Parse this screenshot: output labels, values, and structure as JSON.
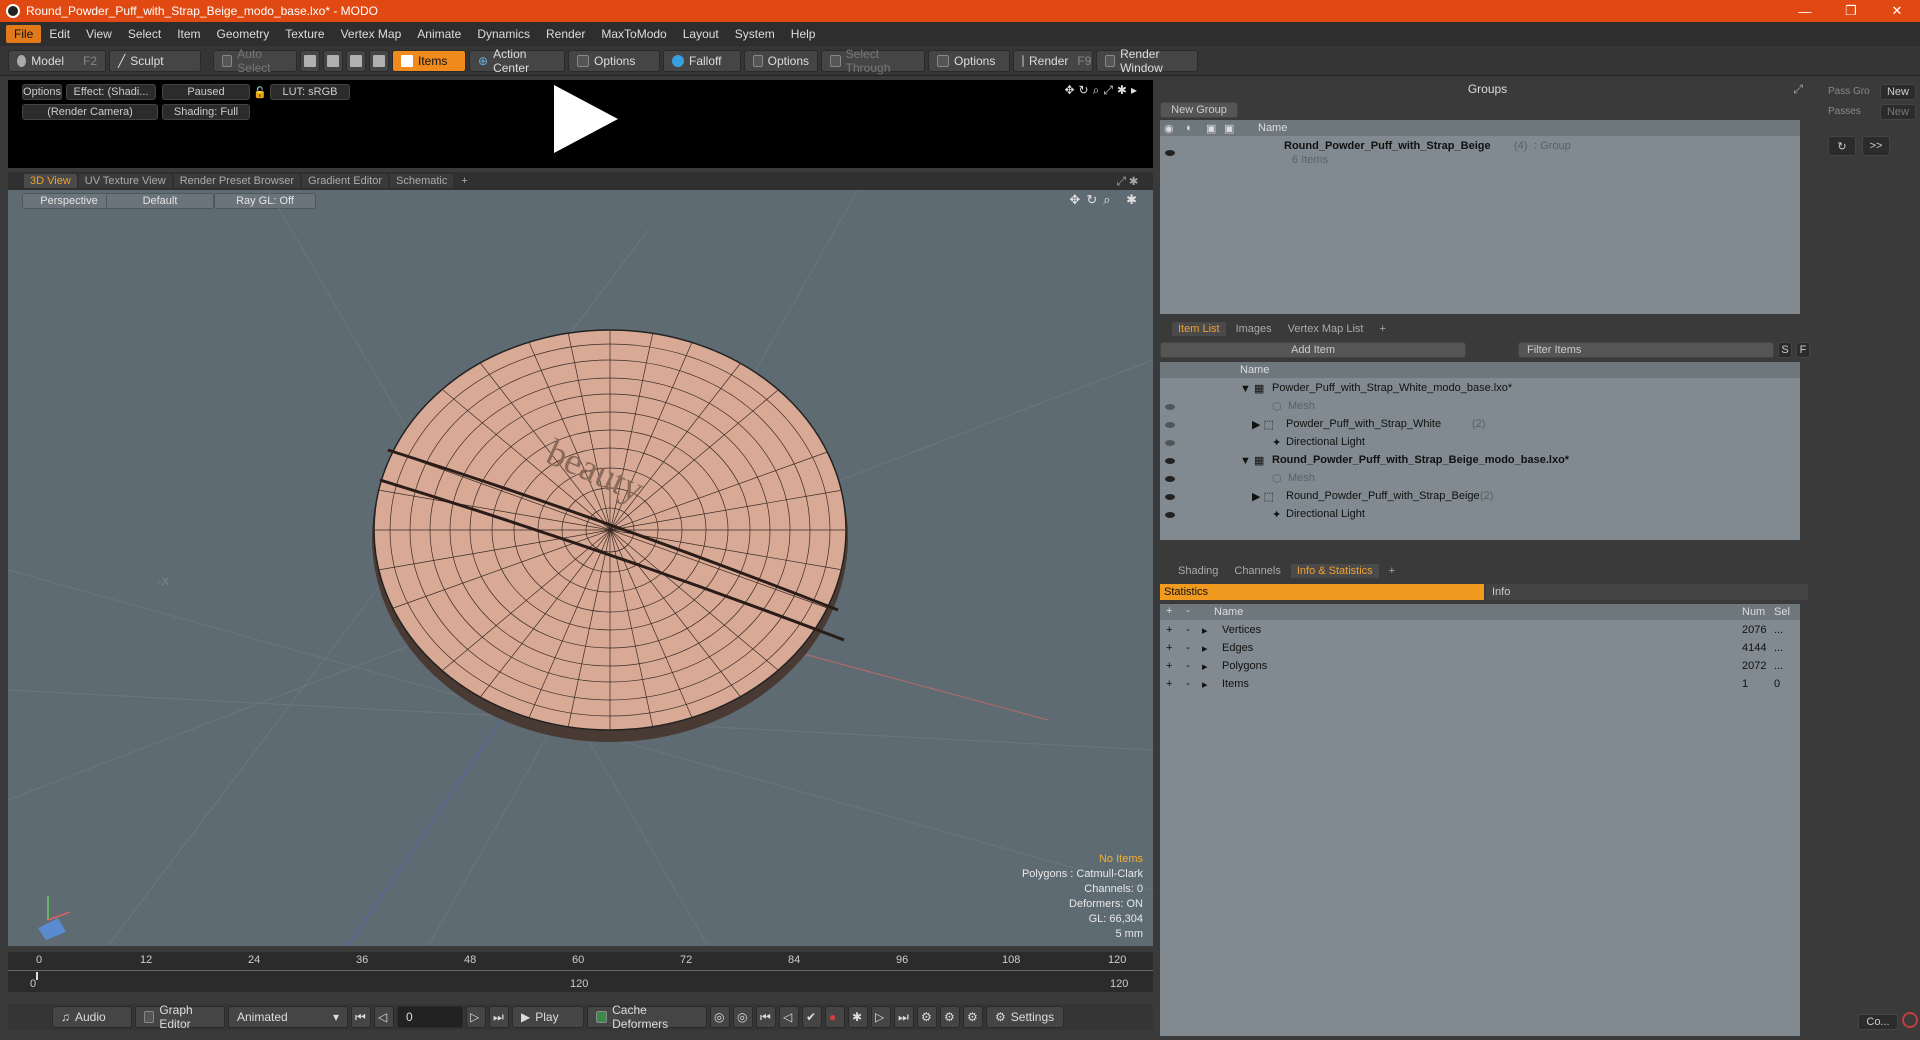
{
  "window": {
    "title": "Round_Powder_Puff_with_Strap_Beige_modo_base.lxo* - MODO",
    "minimize": "—",
    "maximize": "❐",
    "close": "✕"
  },
  "menu": [
    "File",
    "Edit",
    "View",
    "Select",
    "Item",
    "Geometry",
    "Texture",
    "Vertex Map",
    "Animate",
    "Dynamics",
    "Render",
    "MaxToModo",
    "Layout",
    "System",
    "Help"
  ],
  "toolbar": {
    "model": "Model",
    "model_key": "F2",
    "sculpt": "Sculpt",
    "auto_select": "Auto Select",
    "items": "Items",
    "action_center": "Action Center",
    "options1": "Options",
    "falloff": "Falloff",
    "options2": "Options",
    "select_through": "Select Through",
    "options3": "Options",
    "render": "Render",
    "render_key": "F9",
    "render_window": "Render Window"
  },
  "preview": {
    "options": "Options",
    "effect": "Effect: (Shadi...",
    "paused": "Paused",
    "lut": "LUT: sRGB",
    "camera": "(Render Camera)",
    "shading": "Shading: Full"
  },
  "viewport_tabs": [
    "3D View",
    "UV Texture View",
    "Render Preset Browser",
    "Gradient Editor",
    "Schematic",
    "+"
  ],
  "viewport": {
    "perspective": "Perspective",
    "default": "Default",
    "raygl": "Ray GL: Off",
    "label_text": "beauty",
    "stats": {
      "no_items": "No Items",
      "polygons": "Polygons : Catmull-Clark",
      "channels": "Channels: 0",
      "deformers": "Deformers: ON",
      "gl": "GL: 66,304",
      "unit": "5 mm"
    }
  },
  "timeline": {
    "ticks": [
      "0",
      "12",
      "24",
      "36",
      "48",
      "60",
      "72",
      "84",
      "96",
      "108",
      "120"
    ],
    "lower": [
      "0",
      "120",
      "120"
    ]
  },
  "bottombar": {
    "audio": "Audio",
    "graph_editor": "Graph Editor",
    "animated": "Animated",
    "frame": "0",
    "play": "Play",
    "cache": "Cache Deformers",
    "settings": "Settings"
  },
  "groups": {
    "title": "Groups",
    "new_group": "New Group",
    "col_name": "Name",
    "group_name": "Round_Powder_Puff_with_Strap_Beige",
    "group_count": "(4)",
    "group_type": ": Group",
    "group_items": "6 Items"
  },
  "itemlist": {
    "tabs": [
      "Item List",
      "Images",
      "Vertex Map List",
      "+"
    ],
    "add_item": "Add Item",
    "filter": "Filter Items",
    "s": "S",
    "f": "F",
    "col_name": "Name",
    "rows": [
      {
        "label": "Powder_Puff_with_Strap_White_modo_base.lxo*",
        "count": "",
        "style": "scene"
      },
      {
        "label": "Mesh",
        "count": "",
        "style": "dim"
      },
      {
        "label": "Powder_Puff_with_Strap_White",
        "count": "(2)",
        "style": "item"
      },
      {
        "label": "Directional Light",
        "count": "",
        "style": "item"
      },
      {
        "label": "Round_Powder_Puff_with_Strap_Beige_modo_base.lxo*",
        "count": "",
        "style": "scenebold"
      },
      {
        "label": "Mesh",
        "count": "",
        "style": "dim"
      },
      {
        "label": "Round_Powder_Puff_with_Strap_Beige",
        "count": "(2)",
        "style": "item"
      },
      {
        "label": "Directional Light",
        "count": "",
        "style": "item"
      }
    ]
  },
  "info": {
    "tabs": [
      "Shading",
      "Channels",
      "Info & Statistics",
      "+"
    ],
    "statistics": "Statistics",
    "info": "Info",
    "col_name": "Name",
    "col_num": "Num",
    "col_sel": "Sel",
    "rows": [
      {
        "name": "Vertices",
        "num": "2076",
        "sel": "..."
      },
      {
        "name": "Edges",
        "num": "4144",
        "sel": "..."
      },
      {
        "name": "Polygons",
        "num": "2072",
        "sel": "..."
      },
      {
        "name": "Items",
        "num": "1",
        "sel": "0"
      }
    ]
  },
  "passes": {
    "pass_gro": "Pass Gro",
    "new1": "New",
    "passes": "Passes",
    "new2": "New",
    "more": ">>",
    "co": "Co..."
  }
}
